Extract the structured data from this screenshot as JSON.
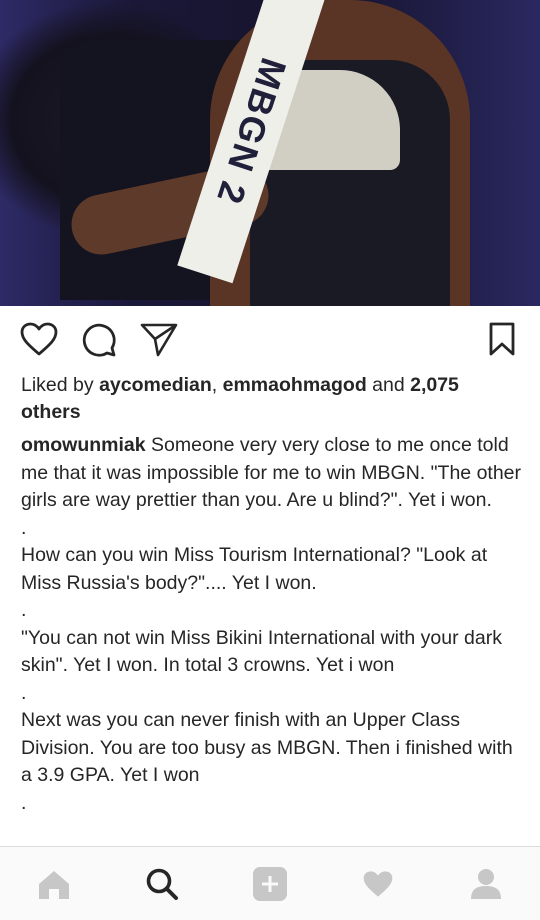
{
  "post": {
    "photo": {
      "description_icon": "post-photo",
      "sash_text": "MBGN 2"
    },
    "likes": {
      "prefix": "Liked by ",
      "user1": "aycomedian",
      "separator": ", ",
      "user2": "emmaohmagod",
      "and_text": " and ",
      "count_text": "2,075 others"
    },
    "caption": {
      "username": "omowunmiak",
      "text": " Someone very very close to me once told me that it was impossible for me to win MBGN. \"The other girls are way prettier than you. Are u blind?\". Yet i won.\n.\nHow can you win Miss Tourism International? \"Look at Miss Russia's body?\".... Yet I won.\n.\n\"You can not win Miss Bikini International with your dark skin\". Yet I won. In total 3 crowns. Yet i won\n.\nNext was you can never finish with an Upper Class Division. You are too busy as MBGN. Then i finished with a 3.9 GPA. Yet I won\n."
    }
  },
  "actions": [
    "heart-icon",
    "comment-icon",
    "share-icon",
    "bookmark-icon"
  ],
  "navbar": [
    "home-icon",
    "search-icon",
    "add-icon",
    "activity-heart-icon",
    "profile-icon"
  ],
  "colors": {
    "text": "#262626",
    "icon_inactive": "#c7c7c7",
    "icon_active": "#262626",
    "navbar_bg": "#fafafa"
  }
}
